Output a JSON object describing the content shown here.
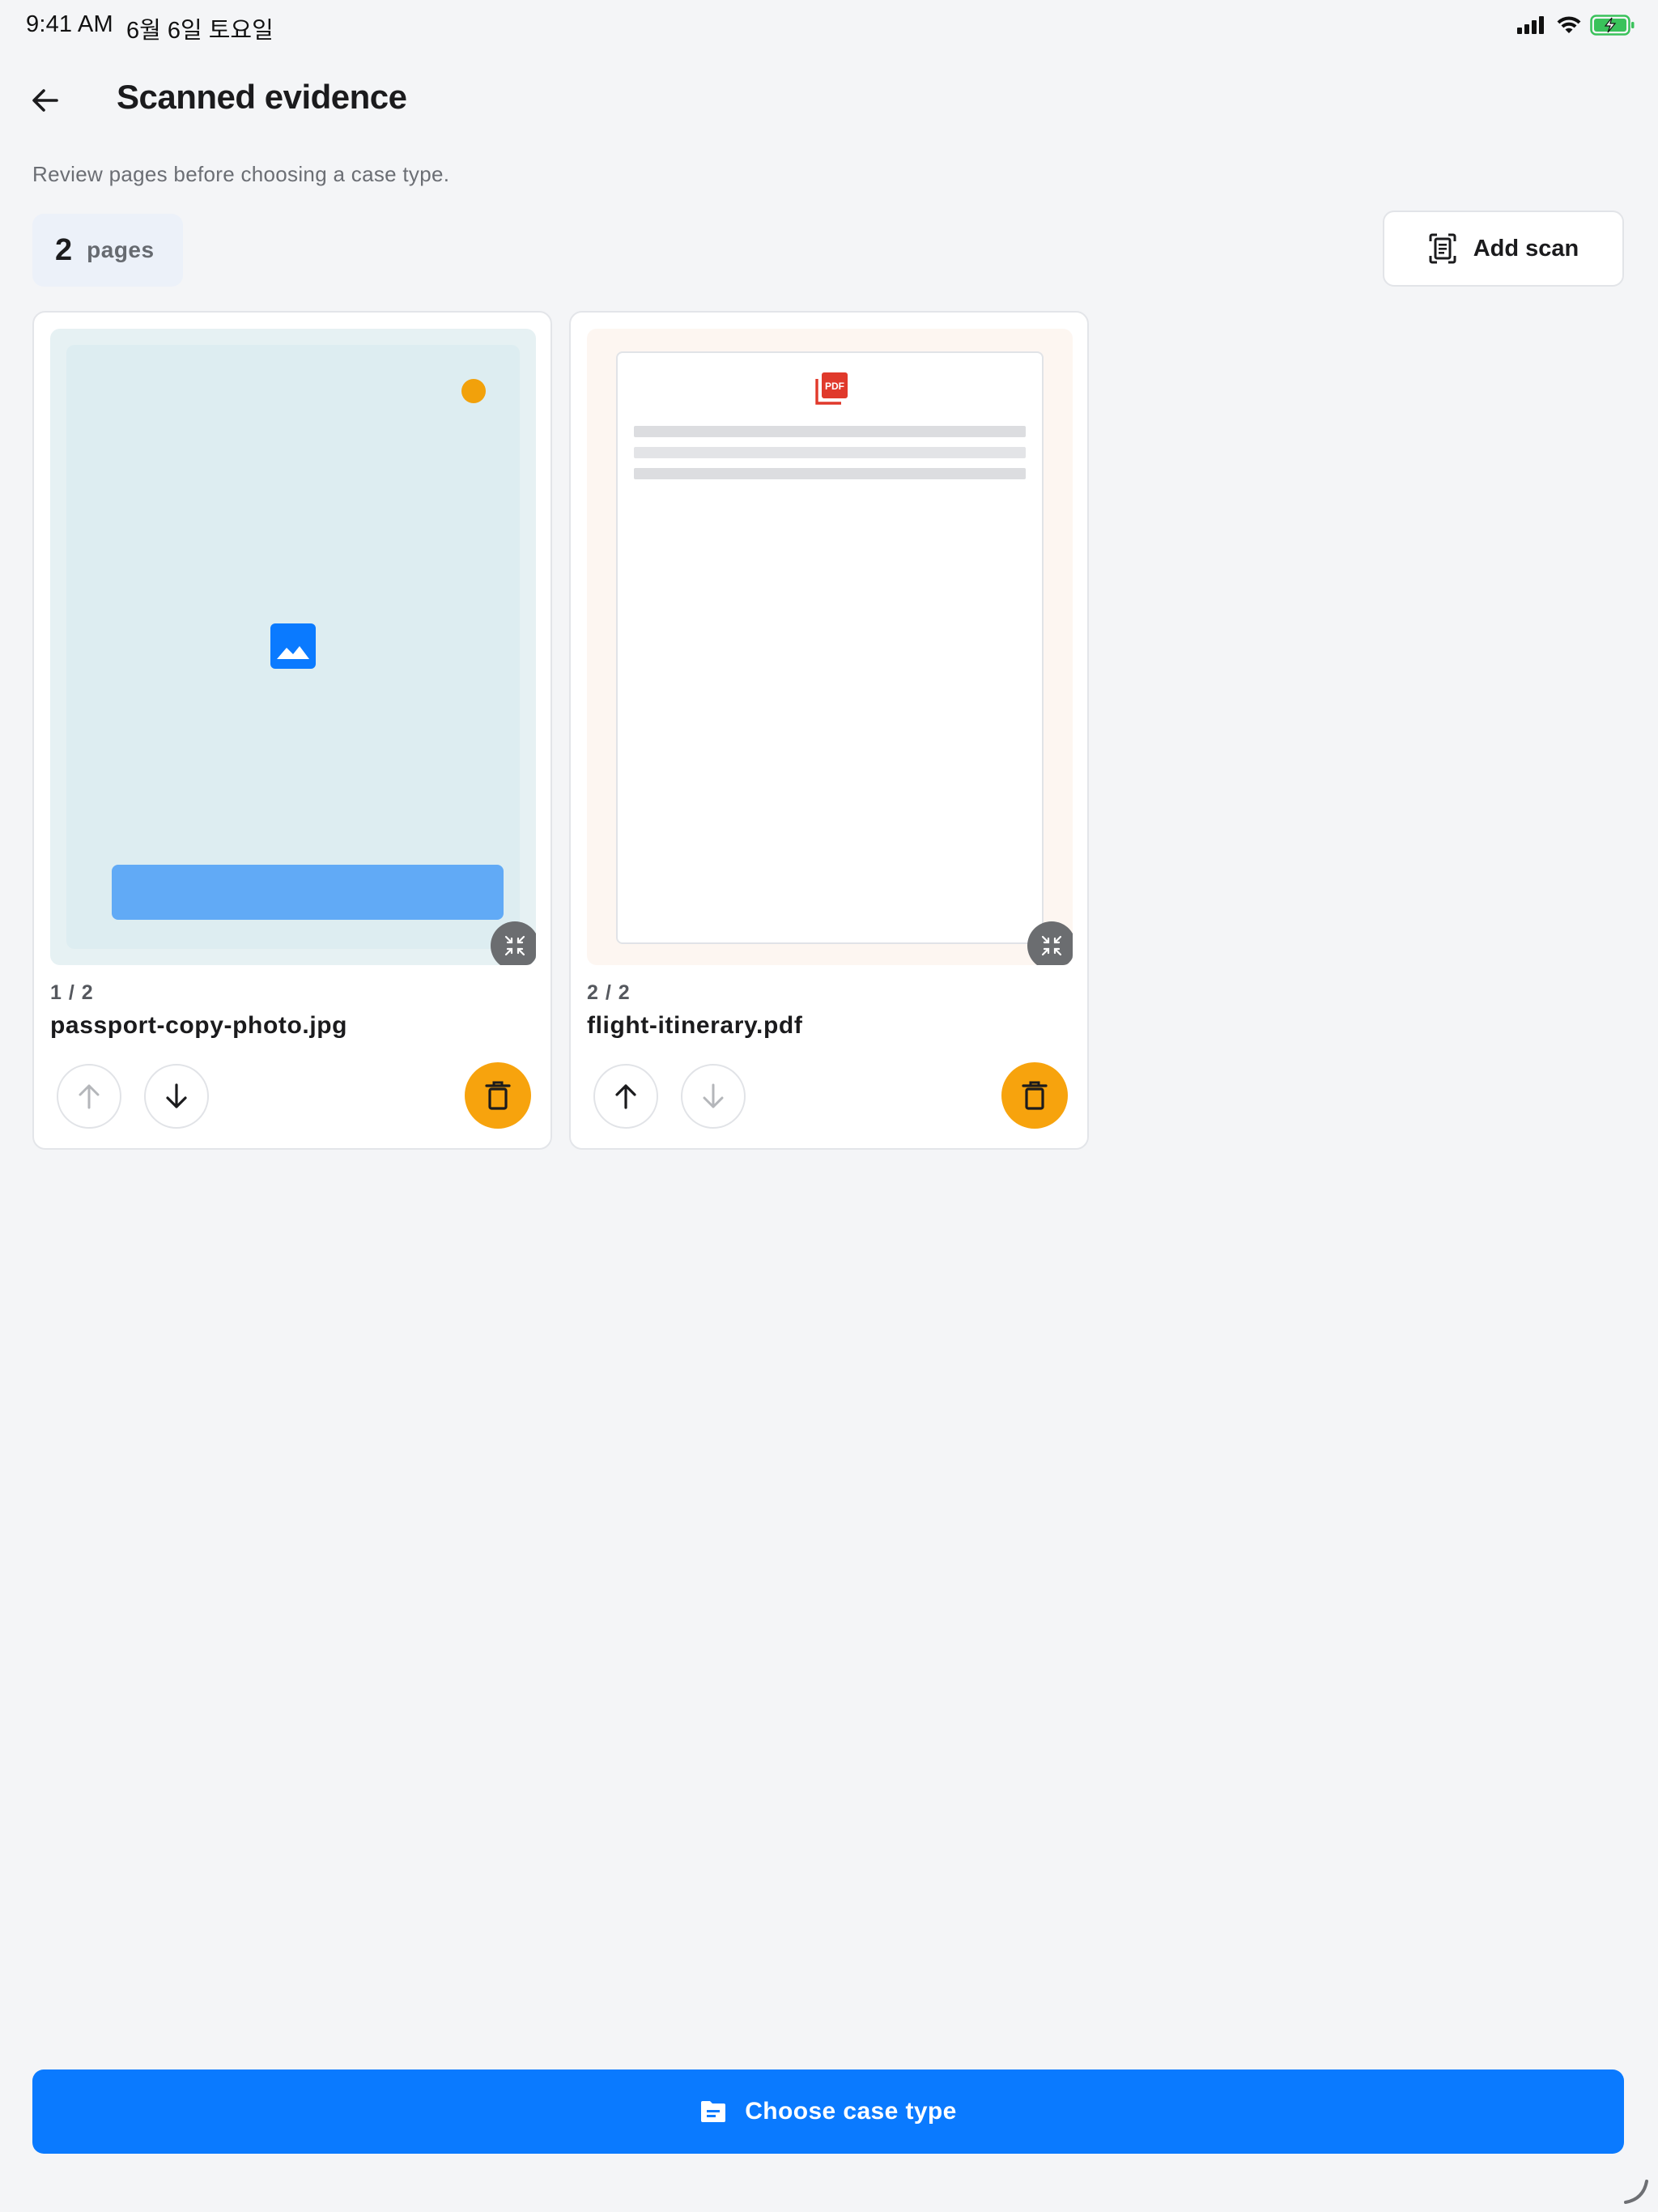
{
  "status_bar": {
    "time": "9:41 AM",
    "date": "6월 6일 토요일",
    "icons": [
      "cellular-signal-icon",
      "wifi-icon",
      "battery-charging-icon"
    ]
  },
  "header": {
    "back_icon": "arrow-left-icon",
    "title": "Scanned evidence"
  },
  "subtitle": "Review pages before choosing a case type.",
  "pages_summary": {
    "count": "2",
    "label": "pages"
  },
  "add_scan": {
    "icon": "document-scan-icon",
    "label": "Add scan"
  },
  "cards": [
    {
      "position": "1 / 2",
      "filename": "passport-copy-photo.jpg",
      "type": "image",
      "thumbnail_icon": "image-icon",
      "move_up_enabled": false,
      "move_down_enabled": true
    },
    {
      "position": "2 / 2",
      "filename": "flight-itinerary.pdf",
      "type": "pdf",
      "thumbnail_icon": "pdf-icon",
      "move_up_enabled": true,
      "move_down_enabled": false
    }
  ],
  "primary_action": {
    "icon": "folder-icon",
    "label": "Choose case type"
  },
  "colors": {
    "primary": "#0a7aff",
    "delete": "#f7a30d",
    "background": "#f4f5f7",
    "status_dot": "#f2a10b",
    "image_bar": "#61aaf6",
    "pdf_red": "#e0392b"
  }
}
